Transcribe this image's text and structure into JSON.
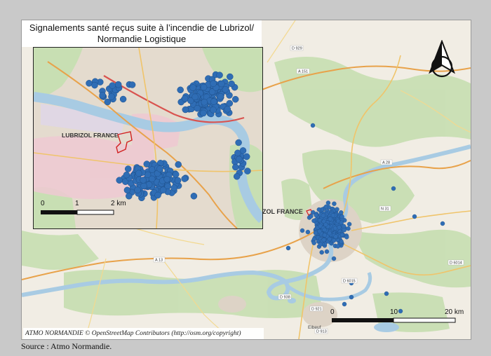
{
  "title": {
    "line1": "Signalements santé reçus suite à l’incendie de Lubrizol/",
    "line2": "Normandie Logistique"
  },
  "inset": {
    "site_label": "LUBRIZOL FRANCE",
    "scale_labels": [
      "0",
      "1",
      "2 km"
    ]
  },
  "main_map": {
    "site_label": "ZOL FRANCE",
    "scale_labels": [
      "0",
      "10",
      "20 km"
    ],
    "road_labels": [
      "D 929",
      "A 151",
      "A 28",
      "N 31",
      "D 6014",
      "A 13",
      "D 938",
      "D 921",
      "D 913",
      "D 6015"
    ],
    "place_labels": [
      "Elbeuf"
    ]
  },
  "attribution": "ATMO NORMANDIE © OpenStreetMap Contributors (http://osm.org/copyright)",
  "source": "Source : Atmo Normandie.",
  "colors": {
    "points": "#2f6db5",
    "water": "#a8cbe3",
    "forest": "#c5deb0",
    "urban": "#e2d9cf",
    "site_outline": "#d12020"
  }
}
